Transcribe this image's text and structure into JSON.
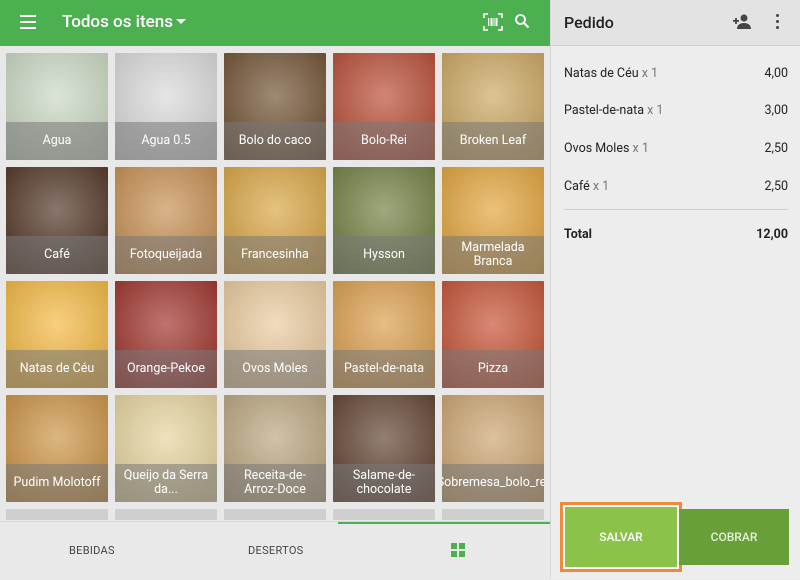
{
  "header": {
    "title": "Todos os itens",
    "icons": [
      "menu-icon",
      "chevron-down-icon",
      "barcode-icon",
      "search-icon"
    ]
  },
  "products": [
    {
      "label": "Agua",
      "color": "#c8d6c0"
    },
    {
      "label": "Agua 0.5",
      "color": "#d8d8d8"
    },
    {
      "label": "Bolo do caco",
      "color": "#6b4a2a"
    },
    {
      "label": "Bolo-Rei",
      "color": "#b5452d"
    },
    {
      "label": "Broken Leaf",
      "color": "#c9a35a"
    },
    {
      "label": "Café",
      "color": "#4a2c1c"
    },
    {
      "label": "Fotoqueijada",
      "color": "#c48a4a"
    },
    {
      "label": "Francesinha",
      "color": "#d7a13c"
    },
    {
      "label": "Hysson",
      "color": "#6b7a3a"
    },
    {
      "label": "Marmelada Branca",
      "color": "#e0a033"
    },
    {
      "label": "Natas de Céu",
      "color": "#f2b53a"
    },
    {
      "label": "Orange-Pekoe",
      "color": "#9b2a22"
    },
    {
      "label": "Ovos Moles",
      "color": "#e8c89a"
    },
    {
      "label": "Pastel-de-nata",
      "color": "#d89a45"
    },
    {
      "label": "Pizza",
      "color": "#c24a2b"
    },
    {
      "label": "Pudim Molotoff",
      "color": "#c98e3c"
    },
    {
      "label": "Queijo da Serra da...",
      "color": "#e5d29a"
    },
    {
      "label": "Receita-de-Arroz-Doce",
      "color": "#b8a27a"
    },
    {
      "label": "Salame-de-chocolate",
      "color": "#5a3a28"
    },
    {
      "label": "Sobremesa_bolo_rei",
      "color": "#c9a06a"
    }
  ],
  "tabs": [
    {
      "label": "BEBIDAS"
    },
    {
      "label": "DESERTOS"
    }
  ],
  "order": {
    "title": "Pedido",
    "icons": [
      "add-person-icon",
      "more-vertical-icon"
    ],
    "lines": [
      {
        "name": "Natas de Céu",
        "qty": "x 1",
        "price": "4,00"
      },
      {
        "name": "Pastel-de-nata",
        "qty": "x 1",
        "price": "3,00"
      },
      {
        "name": "Ovos Moles",
        "qty": "x 1",
        "price": "2,50"
      },
      {
        "name": "Café",
        "qty": "x 1",
        "price": "2,50"
      }
    ],
    "total_label": "Total",
    "total_value": "12,00",
    "save_label": "SALVAR",
    "charge_label": "COBRAR"
  },
  "colors": {
    "brand": "#4caf50",
    "save": "#8bc34a",
    "charge": "#689f38",
    "highlight": "#f08a3a"
  }
}
